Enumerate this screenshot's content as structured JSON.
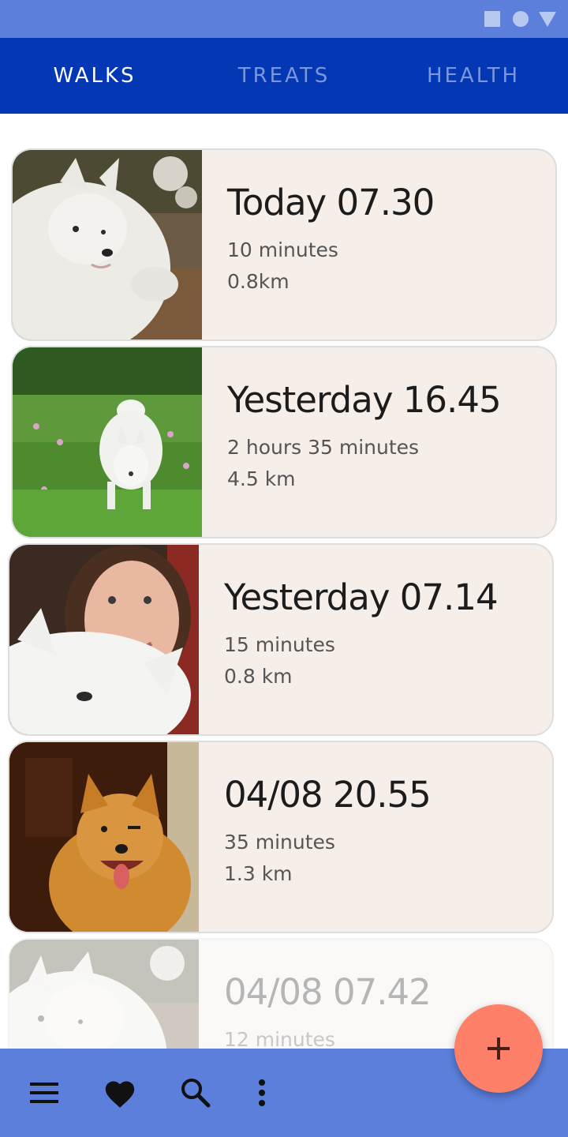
{
  "status_bar": {
    "icons": [
      "square-icon",
      "circle-icon",
      "triangle-icon"
    ],
    "color": "#5b7fdb"
  },
  "tabs": [
    {
      "label": "WALKS",
      "active": true
    },
    {
      "label": "TREATS",
      "active": false
    },
    {
      "label": "HEALTH",
      "active": false
    }
  ],
  "walks": [
    {
      "title": "Today 07.30",
      "duration": "10 minutes",
      "distance": "0.8km",
      "photo": "white-dog-lying-photo"
    },
    {
      "title": "Yesterday 16.45",
      "duration": "2 hours 35 minutes",
      "distance": "4.5 km",
      "photo": "white-dog-in-grass-photo"
    },
    {
      "title": "Yesterday 07.14",
      "duration": "15 minutes",
      "distance": "0.8 km",
      "photo": "woman-with-white-dog-photo"
    },
    {
      "title": "04/08 20.55",
      "duration": "35 minutes",
      "distance": "1.3 km",
      "photo": "orange-dog-smiling-photo"
    },
    {
      "title": "04/08 07.42",
      "duration": "12 minutes",
      "distance": "",
      "photo": "white-dog-lying-photo"
    }
  ],
  "bottom_bar": {
    "icons": [
      "menu-icon",
      "heart-icon",
      "search-icon",
      "more-vert-icon"
    ]
  },
  "fab": {
    "icon": "add-icon",
    "label": "+"
  },
  "colors": {
    "status_bar": "#5b7fdb",
    "tab_bar": "#0337b3",
    "card_bg": "#f5eee9",
    "fab": "#fe8068",
    "bottom_bar": "#5b7fdb"
  }
}
